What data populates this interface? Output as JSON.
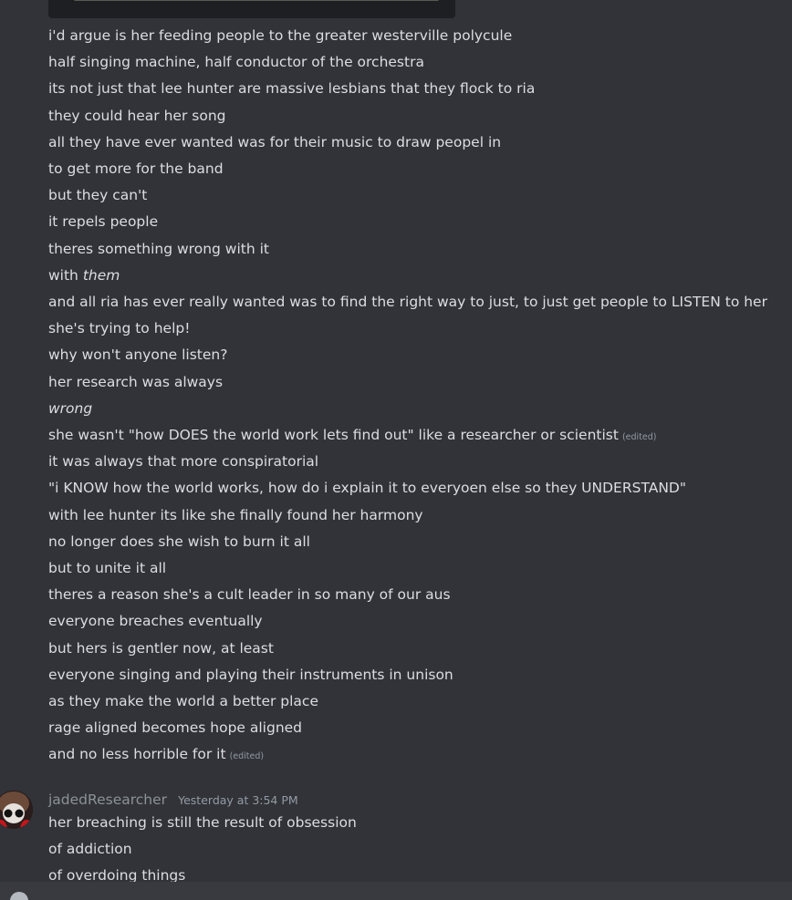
{
  "messages_before": [
    {
      "text": "i'd argue is her feeding people to the greater westerville polycule"
    },
    {
      "text": "half singing machine, half conductor of the orchestra"
    },
    {
      "text": "its not just that lee hunter are massive lesbians that they flock to ria"
    },
    {
      "text": "they could hear her song"
    },
    {
      "text": "all they have ever wanted was for their music to draw peopel in"
    },
    {
      "text": "to get more for the band"
    },
    {
      "text": "but they can't"
    },
    {
      "text": "it repels people"
    },
    {
      "text": "theres something wrong with it"
    },
    {
      "text": "with ",
      "em": "them"
    },
    {
      "text": "and all ria has ever really wanted was to find the right way to just, to just get people to LISTEN to her"
    },
    {
      "text": "she's trying to help!"
    },
    {
      "text": "why won't anyone listen?"
    },
    {
      "text": "her research was always"
    },
    {
      "em": "wrong"
    },
    {
      "text": "she wasn't \"how DOES the world work lets find out\" like a researcher or scientist",
      "edited": "(edited)"
    },
    {
      "text": "it was always that more conspiratorial"
    },
    {
      "text": "\"i KNOW how the world works, how do i explain it to everyoen else so they UNDERSTAND\""
    },
    {
      "text": "with lee hunter its like she finally found her harmony"
    },
    {
      "text": "no longer does she wish to burn it all"
    },
    {
      "text": "but to unite it all"
    },
    {
      "text": "theres a reason she's a cult leader in so many of our aus"
    },
    {
      "text": "everyone breaches eventually"
    },
    {
      "text": "but hers is gentler now, at least"
    },
    {
      "text": "everyone singing and playing their instruments in unison"
    },
    {
      "text": "as they make the world a better place"
    },
    {
      "text": "rage aligned becomes hope aligned"
    },
    {
      "text": "and no less horrible for it",
      "edited": "(edited)"
    }
  ],
  "new_message": {
    "author": "jadedResearcher",
    "timestamp": "Yesterday at 3:54 PM",
    "lines": [
      "her breaching is still the result of obsession",
      "of addiction",
      "of overdoing things"
    ]
  },
  "colors": {
    "background": "#313338",
    "text": "#dbdee1",
    "muted": "#949ba4",
    "username": "#8c9297",
    "composer": "#383a40"
  },
  "icons": {
    "avatar": "avatar-image",
    "composer_add": "plus-circle-icon"
  }
}
